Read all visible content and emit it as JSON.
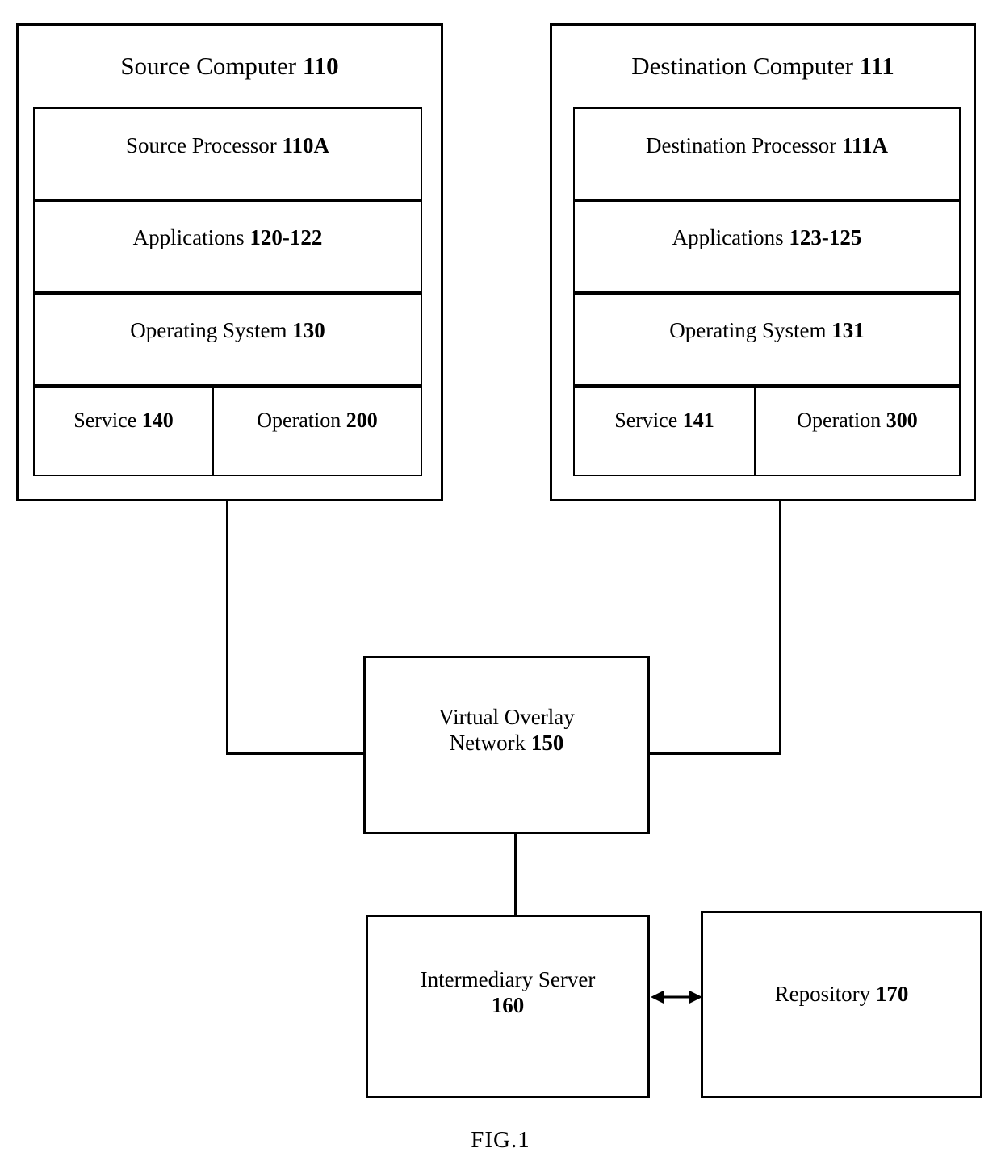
{
  "figure": {
    "caption": "FIG.1"
  },
  "source_computer": {
    "title_text": "Source Computer",
    "title_num": "110",
    "rows": [
      {
        "text": "Source Processor",
        "num": "110A"
      },
      {
        "text": "Applications",
        "num": "120-122"
      },
      {
        "text": "Operating System",
        "num": "130"
      }
    ],
    "cells": [
      {
        "text": "Service",
        "num": "140"
      },
      {
        "text": "Operation",
        "num": "200"
      }
    ]
  },
  "destination_computer": {
    "title_text": "Destination Computer",
    "title_num": "111",
    "rows": [
      {
        "text": "Destination Processor",
        "num": "111A"
      },
      {
        "text": "Applications",
        "num": "123-125"
      },
      {
        "text": "Operating System",
        "num": "131"
      }
    ],
    "cells": [
      {
        "text": "Service",
        "num": "141"
      },
      {
        "text": "Operation",
        "num": "300"
      }
    ]
  },
  "network_node": {
    "line1": "Virtual Overlay",
    "line2_text": "Network",
    "line2_num": "150"
  },
  "server_node": {
    "line1": "Intermediary Server",
    "line2_num": "160"
  },
  "repository_node": {
    "text": "Repository",
    "num": "170"
  },
  "connectors": {
    "source_to_network": "line",
    "destination_to_network": "line",
    "network_to_server": "line",
    "server_to_repository": "double-arrow"
  },
  "colors": {
    "stroke": "#000000",
    "background": "#ffffff"
  }
}
